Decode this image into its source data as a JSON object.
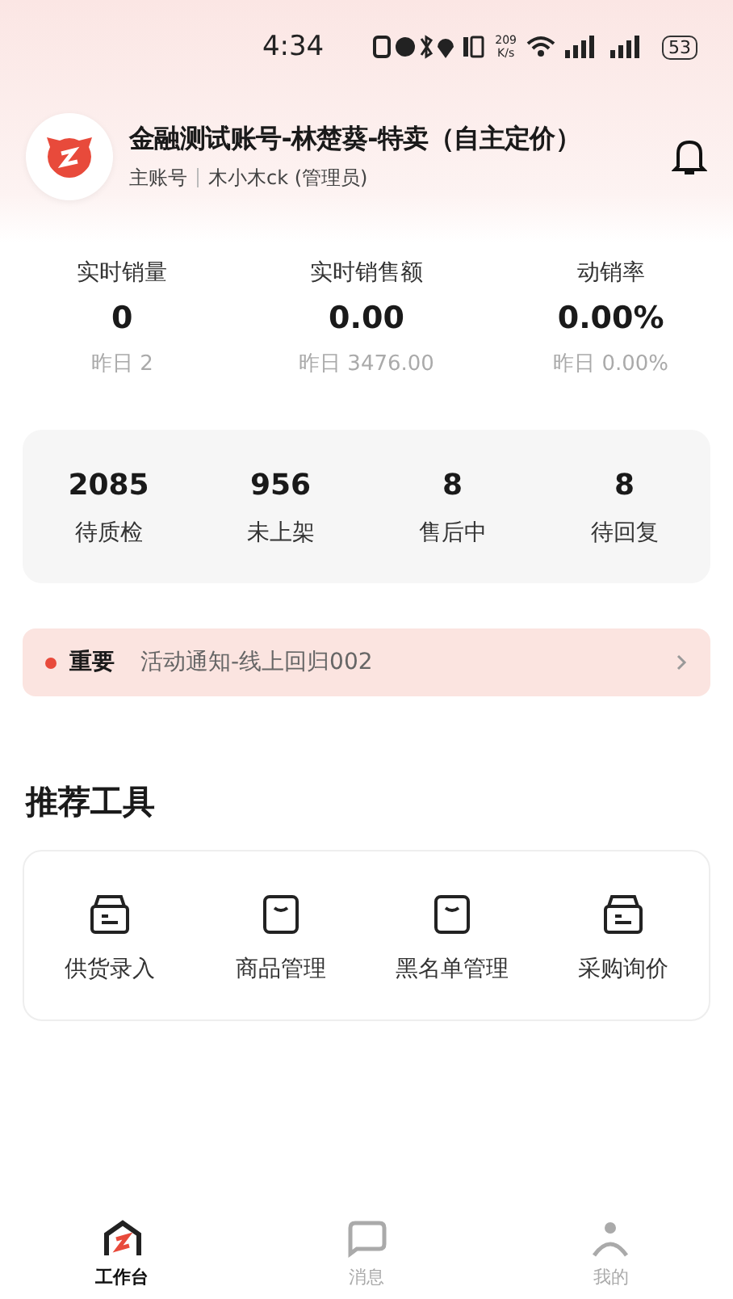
{
  "status_bar": {
    "time": "4:34",
    "speed": "209",
    "speed_unit": "K/s",
    "battery": "53"
  },
  "header": {
    "title": "金融测试账号-林楚葵-特卖（自主定价）",
    "role": "主账号",
    "user": "木小木ck (管理员)"
  },
  "stats": [
    {
      "label": "实时销量",
      "value": "0",
      "yesterday": "昨日 2"
    },
    {
      "label": "实时销售额",
      "value": "0.00",
      "yesterday": "昨日 3476.00"
    },
    {
      "label": "动销率",
      "value": "0.00%",
      "yesterday": "昨日 0.00%"
    }
  ],
  "tasks": [
    {
      "value": "2085",
      "label": "待质检"
    },
    {
      "value": "956",
      "label": "未上架"
    },
    {
      "value": "8",
      "label": "售后中"
    },
    {
      "value": "8",
      "label": "待回复"
    }
  ],
  "notice": {
    "tag": "重要",
    "text": "活动通知-线上回归002"
  },
  "tools_title": "推荐工具",
  "tools": [
    {
      "kind": "box",
      "label": "供货录入"
    },
    {
      "kind": "bag",
      "label": "商品管理"
    },
    {
      "kind": "bag",
      "label": "黑名单管理"
    },
    {
      "kind": "box",
      "label": "采购询价"
    }
  ],
  "tabs": [
    {
      "kind": "home",
      "label": "工作台",
      "selected": true
    },
    {
      "kind": "message",
      "label": "消息",
      "selected": false
    },
    {
      "kind": "profile",
      "label": "我的",
      "selected": false
    }
  ]
}
